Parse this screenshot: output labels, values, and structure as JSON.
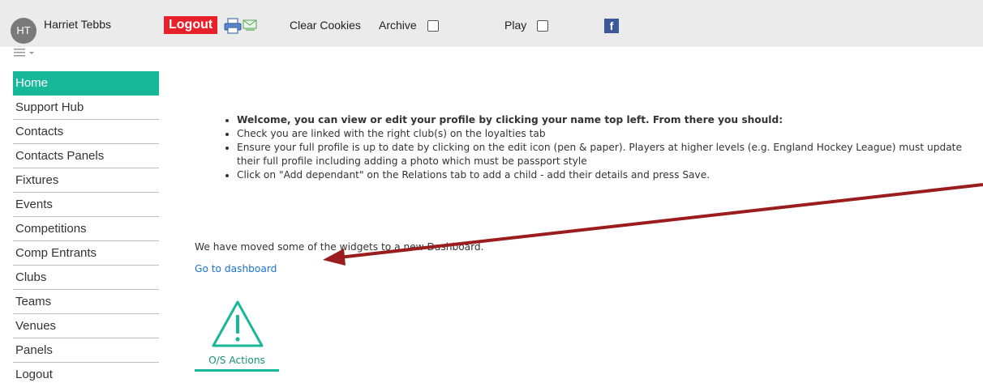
{
  "header": {
    "avatar_initials": "HT",
    "user_name": "Harriet Tebbs",
    "logout_label": "Logout",
    "clear_cookies_label": "Clear Cookies",
    "archive_label": "Archive",
    "play_label": "Play",
    "facebook_label": "f"
  },
  "sidebar": {
    "items": [
      {
        "label": "Home",
        "active": true
      },
      {
        "label": "Support Hub"
      },
      {
        "label": "Contacts"
      },
      {
        "label": "Contacts Panels"
      },
      {
        "label": "Fixtures"
      },
      {
        "label": "Events"
      },
      {
        "label": "Competitions"
      },
      {
        "label": "Comp Entrants"
      },
      {
        "label": "Clubs"
      },
      {
        "label": "Teams"
      },
      {
        "label": "Venues"
      },
      {
        "label": "Panels"
      },
      {
        "label": "Logout"
      }
    ]
  },
  "main": {
    "bullets": [
      "Welcome, you can view or edit your profile by clicking your name top left. From there you should:",
      "Check you are linked with the right club(s) on the loyalties tab",
      "Ensure your full profile is up to date by clicking on the edit icon (pen & paper). Players at higher levels (e.g. England Hockey League) must update their full profile including adding a photo which must be passport style",
      "Click on \"Add dependant\" on the Relations tab to add a child - add their details and press Save."
    ],
    "moved_text": "We have moved some of the widgets to a new Dashboard.",
    "dashboard_link": "Go to dashboard",
    "os_actions_label": "O/S Actions"
  },
  "colors": {
    "accent": "#17b89a",
    "logout": "#e8202a",
    "link": "#1a73d8",
    "arrow": "#9b1c1c"
  }
}
